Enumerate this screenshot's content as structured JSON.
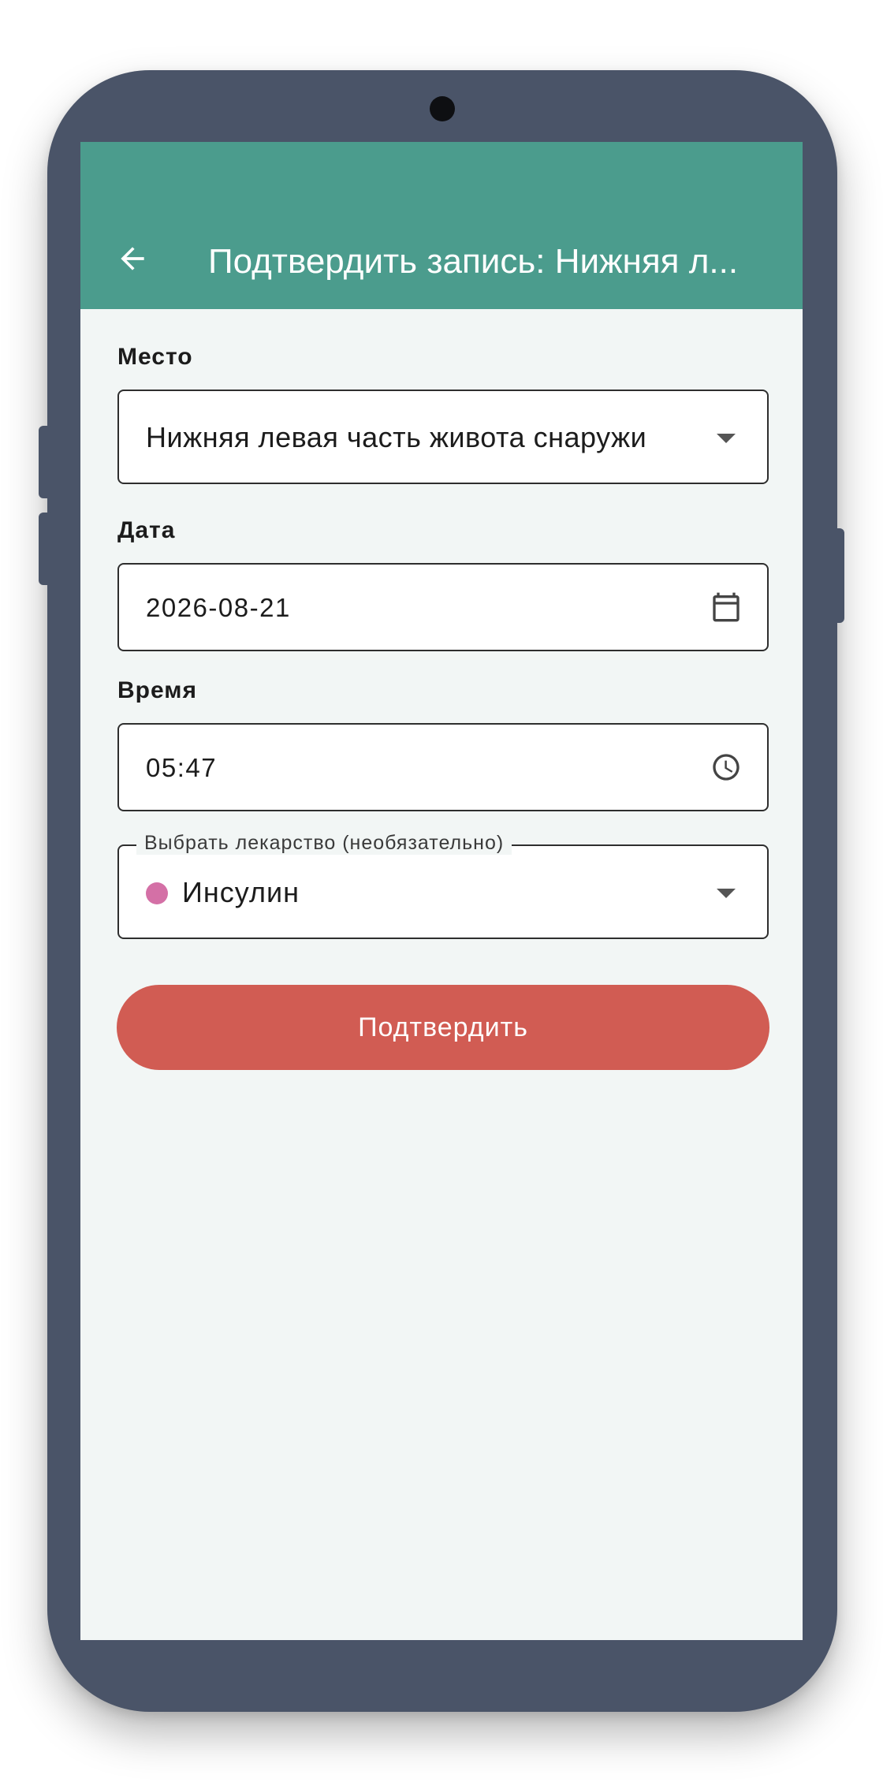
{
  "appbar": {
    "back_icon": "arrow-left-icon",
    "title": "Подтвердить запись: Нижняя л..."
  },
  "form": {
    "location": {
      "label": "Место",
      "value": "Нижняя левая часть живота снаружи",
      "icon": "chevron-down-icon"
    },
    "date": {
      "label": "Дата",
      "value": "2026-08-21",
      "icon": "calendar-icon"
    },
    "time": {
      "label": "Время",
      "value": "05:47",
      "icon": "clock-icon"
    },
    "medication": {
      "label": "Выбрать лекарство (необязательно)",
      "value": "Инсулин",
      "dot_color": "#d470a6",
      "icon": "chevron-down-icon"
    }
  },
  "submit_label": "Подтвердить",
  "colors": {
    "appbar": "#4b9c8d",
    "submit": "#d15c53",
    "device_frame": "#4a5468",
    "screen_background": "#f2f6f5"
  }
}
